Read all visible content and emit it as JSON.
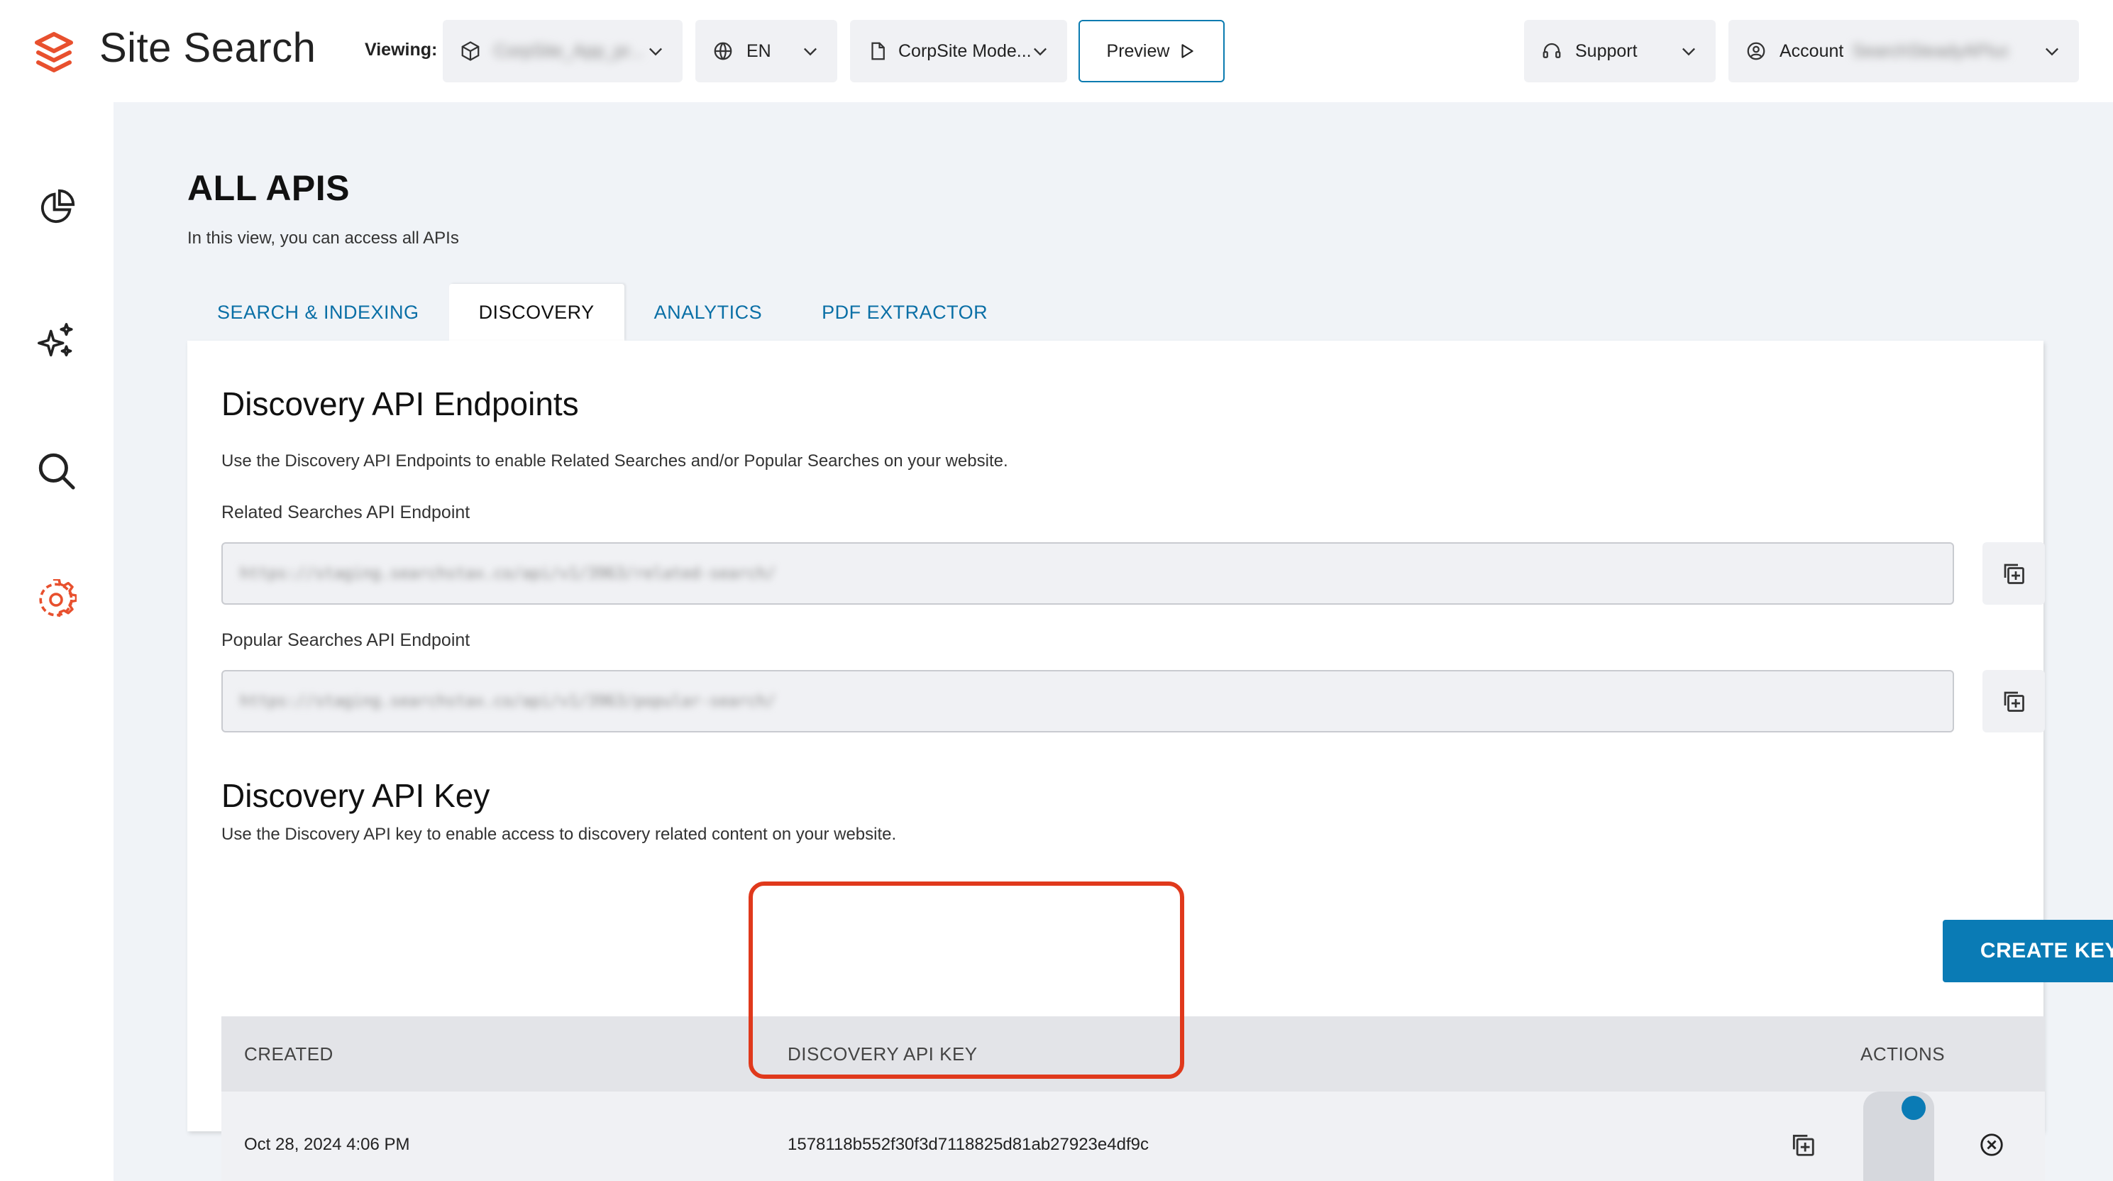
{
  "header": {
    "app_title": "Site Search",
    "viewing_label": "Viewing:",
    "site_selector": {
      "value": "CorpSite_App_pr..."
    },
    "language_selector": {
      "value": "EN"
    },
    "model_selector": {
      "value": "CorpSite Mode..."
    },
    "preview_label": "Preview",
    "support_label": "Support",
    "account_label": "Account",
    "account_user": "SearchSteadyAPIusers"
  },
  "sidebar": {
    "items": [
      {
        "name": "analytics",
        "icon": "pie-chart-icon"
      },
      {
        "name": "ai",
        "icon": "sparkles-icon"
      },
      {
        "name": "search",
        "icon": "search-icon"
      },
      {
        "name": "settings",
        "icon": "gear-icon",
        "active": true
      }
    ]
  },
  "page": {
    "title": "ALL APIS",
    "subtitle": "In this view, you can access all APIs",
    "tabs": [
      {
        "label": "SEARCH & INDEXING"
      },
      {
        "label": "DISCOVERY",
        "active": true
      },
      {
        "label": "ANALYTICS"
      },
      {
        "label": "PDF EXTRACTOR"
      }
    ]
  },
  "endpoints": {
    "heading": "Discovery API Endpoints",
    "description": "Use the Discovery API Endpoints to enable Related Searches and/or Popular Searches on your website.",
    "related_label": "Related Searches API Endpoint",
    "related_value": "https://staging.searchstax.co/api/v1/3963/related-search/",
    "popular_label": "Popular Searches API Endpoint",
    "popular_value": "https://staging.searchstax.co/api/v1/3963/popular-search/"
  },
  "api_key": {
    "heading": "Discovery API Key",
    "description": "Use the Discovery API key to enable access to discovery related content on your website.",
    "create_label": "CREATE KEY",
    "columns": {
      "created": "CREATED",
      "key": "DISCOVERY API KEY",
      "actions": "ACTIONS"
    },
    "rows": [
      {
        "created": "Oct 28, 2024 4:06 PM",
        "key": "1578118b552f30f3d7118825d81ab27923e4df9c",
        "enabled": true
      }
    ]
  },
  "colors": {
    "brand": "#e8502e",
    "accent": "#0a7bb5",
    "highlight": "#e0391c",
    "background": "#f0f3f7"
  }
}
